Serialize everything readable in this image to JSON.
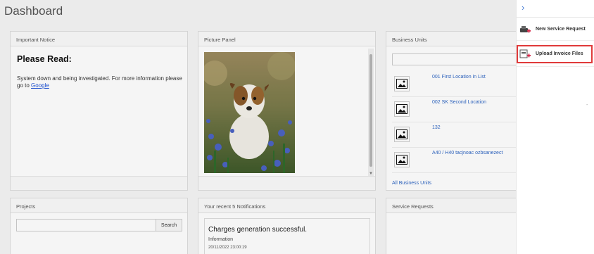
{
  "page": {
    "title": "Dashboard"
  },
  "notice": {
    "header": "Important Notice",
    "heading": "Please Read:",
    "body": "System down and being investigated. For more information please go to",
    "link": "Google"
  },
  "picture": {
    "header": "Picture Panel"
  },
  "business_units": {
    "header": "Business Units",
    "items": [
      {
        "label": "001 First Location in List"
      },
      {
        "label": "002 SK Second Location"
      },
      {
        "label": "132"
      },
      {
        "label": "A40 / H40 tacjnoac ozbsanezect"
      }
    ],
    "footer_link": "All Business Units"
  },
  "projects": {
    "header": "Projects",
    "search_button": "Search"
  },
  "notifications": {
    "header": "Your recent 5 Notifications",
    "items": [
      {
        "title": "Charges generation successful.",
        "type": "Information",
        "date": "20/11/2022 23:00:19"
      }
    ]
  },
  "service_requests": {
    "header": "Service Requests"
  },
  "drawer": {
    "items": [
      {
        "label": "New Service Request",
        "icon": "service-request-icon"
      },
      {
        "label": "Upload Invoice Files",
        "icon": "upload-invoice-icon"
      }
    ],
    "dot": "-"
  }
}
